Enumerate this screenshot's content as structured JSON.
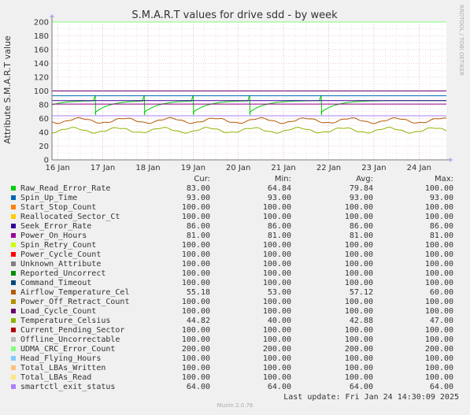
{
  "title": "S.M.A.R.T values for drive sdd - by week",
  "side_text": "RRDTOOL / TOBI OETIKER",
  "ylabel": "Attribute S.M.A.R.T value",
  "legend_header": {
    "cur": "Cur:",
    "min": "Min:",
    "avg": "Avg:",
    "max": "Max:"
  },
  "legend": [
    {
      "name": "Raw_Read_Error_Rate",
      "color": "#00cc00",
      "cur": "83.00",
      "min": "64.84",
      "avg": "79.84",
      "max": "100.00"
    },
    {
      "name": "Spin_Up_Time",
      "color": "#0066b3",
      "cur": "93.00",
      "min": "93.00",
      "avg": "93.00",
      "max": "93.00"
    },
    {
      "name": "Start_Stop_Count",
      "color": "#ff8000",
      "cur": "100.00",
      "min": "100.00",
      "avg": "100.00",
      "max": "100.00"
    },
    {
      "name": "Reallocated_Sector_Ct",
      "color": "#ffcc00",
      "cur": "100.00",
      "min": "100.00",
      "avg": "100.00",
      "max": "100.00"
    },
    {
      "name": "Seek_Error_Rate",
      "color": "#330099",
      "cur": "86.00",
      "min": "86.00",
      "avg": "86.00",
      "max": "86.00"
    },
    {
      "name": "Power_On_Hours",
      "color": "#990099",
      "cur": "81.00",
      "min": "81.00",
      "avg": "81.00",
      "max": "81.00"
    },
    {
      "name": "Spin_Retry_Count",
      "color": "#ccff00",
      "cur": "100.00",
      "min": "100.00",
      "avg": "100.00",
      "max": "100.00"
    },
    {
      "name": "Power_Cycle_Count",
      "color": "#ff0000",
      "cur": "100.00",
      "min": "100.00",
      "avg": "100.00",
      "max": "100.00"
    },
    {
      "name": "Unknown_Attribute",
      "color": "#808080",
      "cur": "100.00",
      "min": "100.00",
      "avg": "100.00",
      "max": "100.00"
    },
    {
      "name": "Reported_Uncorrect",
      "color": "#008f00",
      "cur": "100.00",
      "min": "100.00",
      "avg": "100.00",
      "max": "100.00"
    },
    {
      "name": "Command_Timeout",
      "color": "#00487d",
      "cur": "100.00",
      "min": "100.00",
      "avg": "100.00",
      "max": "100.00"
    },
    {
      "name": "Airflow_Temperature_Cel",
      "color": "#b35a00",
      "cur": "55.18",
      "min": "53.00",
      "avg": "57.12",
      "max": "60.00"
    },
    {
      "name": "Power_Off_Retract_Count",
      "color": "#b38f00",
      "cur": "100.00",
      "min": "100.00",
      "avg": "100.00",
      "max": "100.00"
    },
    {
      "name": "Load_Cycle_Count",
      "color": "#6b006b",
      "cur": "100.00",
      "min": "100.00",
      "avg": "100.00",
      "max": "100.00"
    },
    {
      "name": "Temperature_Celsius",
      "color": "#8fb300",
      "cur": "44.82",
      "min": "40.00",
      "avg": "42.88",
      "max": "47.00"
    },
    {
      "name": "Current_Pending_Sector",
      "color": "#b30000",
      "cur": "100.00",
      "min": "100.00",
      "avg": "100.00",
      "max": "100.00"
    },
    {
      "name": "Offline_Uncorrectable",
      "color": "#bebebe",
      "cur": "100.00",
      "min": "100.00",
      "avg": "100.00",
      "max": "100.00"
    },
    {
      "name": "UDMA_CRC_Error_Count",
      "color": "#80ff80",
      "cur": "200.00",
      "min": "200.00",
      "avg": "200.00",
      "max": "200.00"
    },
    {
      "name": "Head_Flying_Hours",
      "color": "#80c9ff",
      "cur": "100.00",
      "min": "100.00",
      "avg": "100.00",
      "max": "100.00"
    },
    {
      "name": "Total_LBAs_Written",
      "color": "#ffc080",
      "cur": "100.00",
      "min": "100.00",
      "avg": "100.00",
      "max": "100.00"
    },
    {
      "name": "Total_LBAs_Read",
      "color": "#ffe680",
      "cur": "100.00",
      "min": "100.00",
      "avg": "100.00",
      "max": "100.00"
    },
    {
      "name": "smartctl_exit_status",
      "color": "#aa80ff",
      "cur": "64.00",
      "min": "64.00",
      "avg": "64.00",
      "max": "64.00"
    }
  ],
  "footer": {
    "last_update": "Last update: Fri Jan 24 14:30:09 2025",
    "generator": "Munin 2.0.76"
  },
  "chart_data": {
    "type": "line",
    "title": "S.M.A.R.T values for drive sdd - by week",
    "xlabel": "",
    "ylabel": "Attribute S.M.A.R.T value",
    "ylim": [
      0,
      200
    ],
    "xlim": [
      "2025-01-15T21:00",
      "2025-01-24T14:30"
    ],
    "x_ticks": [
      "16 Jan",
      "17 Jan",
      "18 Jan",
      "19 Jan",
      "20 Jan",
      "21 Jan",
      "22 Jan",
      "23 Jan",
      "24 Jan"
    ],
    "y_ticks": [
      0,
      20,
      40,
      60,
      80,
      100,
      120,
      140,
      160,
      180,
      200
    ],
    "grid": true,
    "series": [
      {
        "name": "Raw_Read_Error_Rate",
        "color": "#00cc00",
        "kind": "sawtooth",
        "resets": [
          "2025-01-16T20:00",
          "2025-01-17T22:00",
          "2025-01-19T00:00",
          "2025-01-20T06:00",
          "2025-01-21T20:00"
        ],
        "low": 65,
        "high": 86
      },
      {
        "name": "Spin_Up_Time",
        "color": "#0066b3",
        "kind": "const",
        "value": 93
      },
      {
        "name": "Seek_Error_Rate",
        "color": "#330099",
        "kind": "const",
        "value": 86
      },
      {
        "name": "Power_On_Hours",
        "color": "#990099",
        "kind": "const",
        "value": 81
      },
      {
        "name": "Airflow_Temperature_Cel",
        "color": "#b35a00",
        "kind": "wave",
        "mean": 57,
        "amp": 3.5
      },
      {
        "name": "Temperature_Celsius",
        "color": "#8fb300",
        "kind": "wave",
        "mean": 43,
        "amp": 3.5
      },
      {
        "name": "smartctl_exit_status",
        "color": "#aa80ff",
        "kind": "const",
        "value": 64
      },
      {
        "name": "Power_Cycle_Count",
        "color": "#ff0000",
        "kind": "const",
        "value": 100
      },
      {
        "name": "Load_Cycle_Count",
        "color": "#6b006b",
        "kind": "const",
        "value": 100
      },
      {
        "name": "UDMA_CRC_Error_Count",
        "color": "#80ff80",
        "kind": "const",
        "value": 200
      }
    ]
  }
}
